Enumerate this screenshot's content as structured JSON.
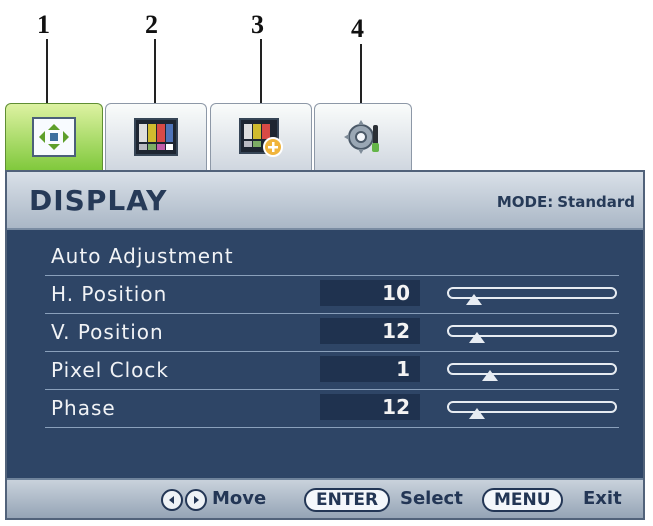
{
  "callouts": [
    "1",
    "2",
    "3",
    "4"
  ],
  "tabs": [
    {
      "icon": "display-move-icon",
      "active": true
    },
    {
      "icon": "color-bars-icon",
      "active": false
    },
    {
      "icon": "color-plus-icon",
      "active": false
    },
    {
      "icon": "gear-tools-icon",
      "active": false
    }
  ],
  "header": {
    "title": "DISPLAY",
    "mode_label": "MODE:",
    "mode_value": "Standard"
  },
  "rows": [
    {
      "label": "Auto Adjustment"
    },
    {
      "label": "H. Position",
      "value": "10",
      "slider_level": 0.1
    },
    {
      "label": "V. Position",
      "value": "12",
      "slider_level": 0.12
    },
    {
      "label": "Pixel Clock",
      "value": "1",
      "slider_level": 0.2
    },
    {
      "label": "Phase",
      "value": "12",
      "slider_level": 0.12
    }
  ],
  "footer": {
    "move": "Move",
    "enter": "ENTER",
    "select": "Select",
    "menu": "MENU",
    "exit": "Exit"
  },
  "colors": {
    "accent_green": "#7fc83b",
    "panel": "#2f4565",
    "header": "#c7d0dc"
  }
}
